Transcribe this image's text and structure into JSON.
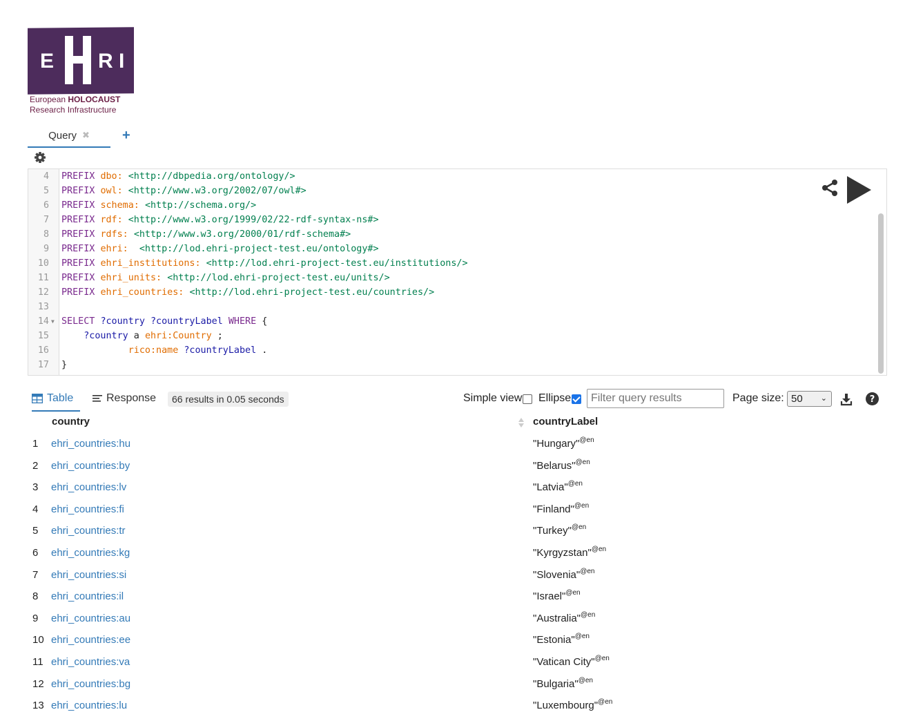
{
  "logo": {
    "letters": [
      "E",
      "H",
      "R",
      "I"
    ],
    "line1_normal": "European",
    "line1_bold": "HOLOCAUST",
    "line2": "Research Infrastructure",
    "brand_color": "#4d2c5c",
    "subtitle_color": "#6b1e45"
  },
  "tabs": {
    "query_label": "Query",
    "close_symbol": "✖",
    "add_symbol": "+"
  },
  "editor": {
    "lines": [
      {
        "n": "4",
        "fold": "",
        "tokens": [
          {
            "t": "PREFIX ",
            "c": "kw"
          },
          {
            "t": "dbo:",
            "c": "pfx"
          },
          {
            "t": " ",
            "c": "punct"
          },
          {
            "t": "<http://dbpedia.org/ontology/>",
            "c": "iri"
          }
        ]
      },
      {
        "n": "5",
        "fold": "",
        "tokens": [
          {
            "t": "PREFIX ",
            "c": "kw"
          },
          {
            "t": "owl:",
            "c": "pfx"
          },
          {
            "t": " ",
            "c": "punct"
          },
          {
            "t": "<http://www.w3.org/2002/07/owl#>",
            "c": "iri"
          }
        ]
      },
      {
        "n": "6",
        "fold": "",
        "tokens": [
          {
            "t": "PREFIX ",
            "c": "kw"
          },
          {
            "t": "schema:",
            "c": "pfx"
          },
          {
            "t": " ",
            "c": "punct"
          },
          {
            "t": "<http://schema.org/>",
            "c": "iri"
          }
        ]
      },
      {
        "n": "7",
        "fold": "",
        "tokens": [
          {
            "t": "PREFIX ",
            "c": "kw"
          },
          {
            "t": "rdf:",
            "c": "pfx"
          },
          {
            "t": " ",
            "c": "punct"
          },
          {
            "t": "<http://www.w3.org/1999/02/22-rdf-syntax-ns#>",
            "c": "iri"
          }
        ]
      },
      {
        "n": "8",
        "fold": "",
        "tokens": [
          {
            "t": "PREFIX ",
            "c": "kw"
          },
          {
            "t": "rdfs:",
            "c": "pfx"
          },
          {
            "t": " ",
            "c": "punct"
          },
          {
            "t": "<http://www.w3.org/2000/01/rdf-schema#>",
            "c": "iri"
          }
        ]
      },
      {
        "n": "9",
        "fold": "",
        "tokens": [
          {
            "t": "PREFIX ",
            "c": "kw"
          },
          {
            "t": "ehri:",
            "c": "pfx"
          },
          {
            "t": "  ",
            "c": "punct"
          },
          {
            "t": "<http://lod.ehri-project-test.eu/ontology#>",
            "c": "iri"
          }
        ]
      },
      {
        "n": "10",
        "fold": "",
        "tokens": [
          {
            "t": "PREFIX ",
            "c": "kw"
          },
          {
            "t": "ehri_institutions:",
            "c": "pfx"
          },
          {
            "t": " ",
            "c": "punct"
          },
          {
            "t": "<http://lod.ehri-project-test.eu/institutions/>",
            "c": "iri"
          }
        ]
      },
      {
        "n": "11",
        "fold": "",
        "tokens": [
          {
            "t": "PREFIX ",
            "c": "kw"
          },
          {
            "t": "ehri_units:",
            "c": "pfx"
          },
          {
            "t": " ",
            "c": "punct"
          },
          {
            "t": "<http://lod.ehri-project-test.eu/units/>",
            "c": "iri"
          }
        ]
      },
      {
        "n": "12",
        "fold": "",
        "tokens": [
          {
            "t": "PREFIX ",
            "c": "kw"
          },
          {
            "t": "ehri_countries:",
            "c": "pfx"
          },
          {
            "t": " ",
            "c": "punct"
          },
          {
            "t": "<http://lod.ehri-project-test.eu/countries/>",
            "c": "iri"
          }
        ]
      },
      {
        "n": "13",
        "fold": "",
        "tokens": []
      },
      {
        "n": "14",
        "fold": "▼",
        "tokens": [
          {
            "t": "SELECT ",
            "c": "kw"
          },
          {
            "t": "?country ?countryLabel ",
            "c": "var"
          },
          {
            "t": "WHERE",
            "c": "kw"
          },
          {
            "t": " {",
            "c": "punct"
          }
        ]
      },
      {
        "n": "15",
        "fold": "",
        "tokens": [
          {
            "t": "    ",
            "c": "punct"
          },
          {
            "t": "?country",
            "c": "var"
          },
          {
            "t": " a ",
            "c": "punct"
          },
          {
            "t": "ehri:Country",
            "c": "pfx"
          },
          {
            "t": " ;",
            "c": "punct"
          }
        ]
      },
      {
        "n": "16",
        "fold": "",
        "tokens": [
          {
            "t": "            ",
            "c": "punct"
          },
          {
            "t": "rico:name",
            "c": "pfx"
          },
          {
            "t": " ",
            "c": "punct"
          },
          {
            "t": "?countryLabel",
            "c": "var"
          },
          {
            "t": " .",
            "c": "punct"
          }
        ]
      },
      {
        "n": "17",
        "fold": "",
        "tokens": [
          {
            "t": "}",
            "c": "punct"
          }
        ]
      }
    ]
  },
  "results": {
    "table_tab": "Table",
    "response_tab": "Response",
    "count_text": "66 results in 0.05 seconds",
    "simple_view_label": "Simple view",
    "simple_view_checked": false,
    "ellipse_label": "Ellipse",
    "ellipse_checked": true,
    "filter_placeholder": "Filter query results",
    "page_size_label": "Page size:",
    "page_size_value": "50",
    "columns": [
      "country",
      "countryLabel"
    ],
    "rows": [
      {
        "i": "1",
        "country": "ehri_countries:hu",
        "label": "\"Hungary\"",
        "lang": "@en"
      },
      {
        "i": "2",
        "country": "ehri_countries:by",
        "label": "\"Belarus\"",
        "lang": "@en"
      },
      {
        "i": "3",
        "country": "ehri_countries:lv",
        "label": "\"Latvia\"",
        "lang": "@en"
      },
      {
        "i": "4",
        "country": "ehri_countries:fi",
        "label": "\"Finland\"",
        "lang": "@en"
      },
      {
        "i": "5",
        "country": "ehri_countries:tr",
        "label": "\"Turkey\"",
        "lang": "@en"
      },
      {
        "i": "6",
        "country": "ehri_countries:kg",
        "label": "\"Kyrgyzstan\"",
        "lang": "@en"
      },
      {
        "i": "7",
        "country": "ehri_countries:si",
        "label": "\"Slovenia\"",
        "lang": "@en"
      },
      {
        "i": "8",
        "country": "ehri_countries:il",
        "label": "\"Israel\"",
        "lang": "@en"
      },
      {
        "i": "9",
        "country": "ehri_countries:au",
        "label": "\"Australia\"",
        "lang": "@en"
      },
      {
        "i": "10",
        "country": "ehri_countries:ee",
        "label": "\"Estonia\"",
        "lang": "@en"
      },
      {
        "i": "11",
        "country": "ehri_countries:va",
        "label": "\"Vatican City\"",
        "lang": "@en"
      },
      {
        "i": "12",
        "country": "ehri_countries:bg",
        "label": "\"Bulgaria\"",
        "lang": "@en"
      },
      {
        "i": "13",
        "country": "ehri_countries:lu",
        "label": "\"Luxembourg\"",
        "lang": "@en"
      }
    ]
  },
  "colors": {
    "link": "#337ab7",
    "keyword": "#7a2a8e",
    "prefix": "#e06c00",
    "iri": "#007f4e",
    "variable": "#1a1aa6"
  }
}
